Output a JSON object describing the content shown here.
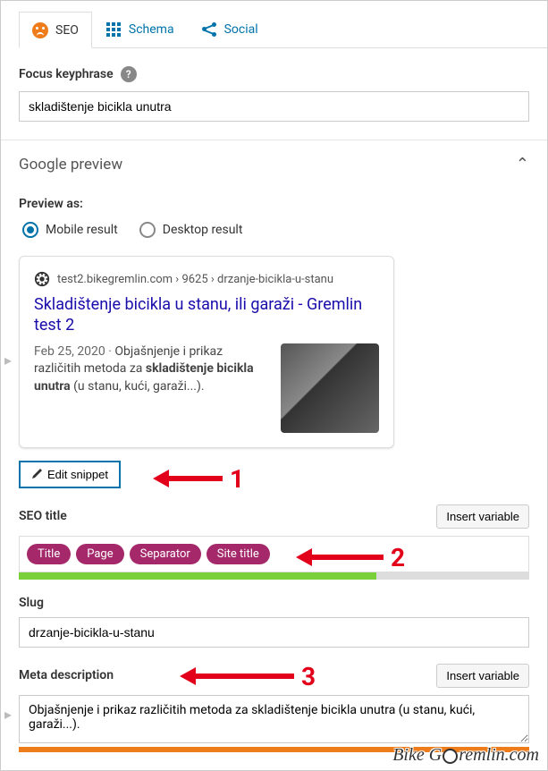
{
  "tabs": {
    "seo": "SEO",
    "schema": "Schema",
    "social": "Social"
  },
  "focus": {
    "label": "Focus keyphrase",
    "value": "skladištenje bicikla unutra"
  },
  "google_preview": {
    "header": "Google preview",
    "preview_as_label": "Preview as:",
    "mobile_label": "Mobile result",
    "desktop_label": "Desktop result",
    "url_line": "test2.bikegremlin.com › 9625 › drzanje-bicikla-u-stanu",
    "title": "Skladištenje bicikla u stanu, ili garaži - Gremlin test 2",
    "date": "Feb 25, 2020",
    "desc_pre": "Objašnjenje i prikaz različitih metoda za ",
    "desc_bold": "skladištenje bicikla unutra",
    "desc_post": " (u stanu, kući, garaži...)."
  },
  "edit_snippet": "Edit snippet",
  "seo_title": {
    "label": "SEO title",
    "insert": "Insert variable",
    "pills": [
      "Title",
      "Page",
      "Separator",
      "Site title"
    ]
  },
  "slug": {
    "label": "Slug",
    "value": "drzanje-bicikla-u-stanu"
  },
  "meta": {
    "label": "Meta description",
    "insert": "Insert variable",
    "value": "Objašnjenje i prikaz različitih metoda za skladištenje bicikla unutra (u stanu, kući, garaži...)."
  },
  "annotations": {
    "n1": "1",
    "n2": "2",
    "n3": "3"
  },
  "watermark_a": "Bike G",
  "watermark_b": "remlin.com"
}
